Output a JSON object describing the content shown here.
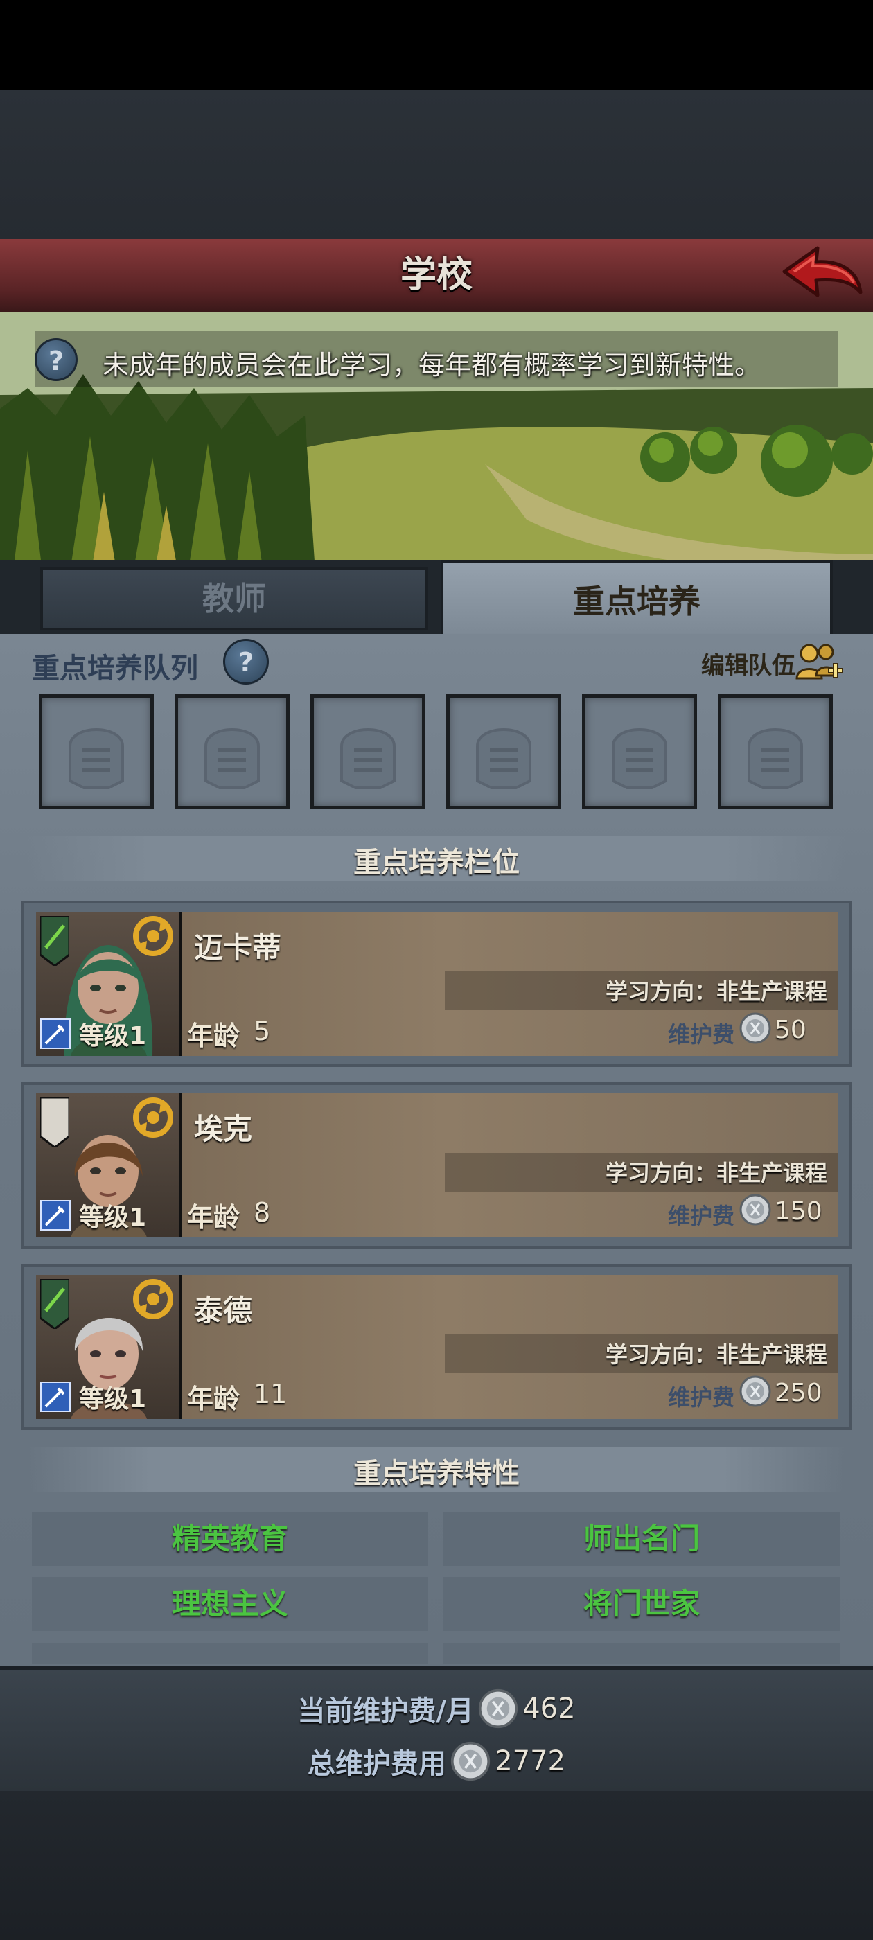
{
  "header": {
    "title": "学校"
  },
  "info": {
    "text": "未成年的成员会在此学习，每年都有概率学习到新特性。",
    "help_symbol": "?"
  },
  "tabs": [
    {
      "label": "教师",
      "active": false
    },
    {
      "label": "重点培养",
      "active": true
    }
  ],
  "queue": {
    "label": "重点培养队列",
    "help_symbol": "?",
    "edit_label": "编辑队伍",
    "slot_count": 6
  },
  "slots_section": {
    "title": "重点培养栏位"
  },
  "members": [
    {
      "name": "迈卡蒂",
      "level_label": "等级1",
      "age_label": "年龄",
      "age": "5",
      "study": "学习方向：非生产课程",
      "fee_label": "维护费",
      "fee": "50",
      "hair_color": "#2f6b4f",
      "banner": "green"
    },
    {
      "name": "埃克",
      "level_label": "等级1",
      "age_label": "年龄",
      "age": "8",
      "study": "学习方向：非生产课程",
      "fee_label": "维护费",
      "fee": "150",
      "hair_color": "#6a4427",
      "banner": "white"
    },
    {
      "name": "泰德",
      "level_label": "等级1",
      "age_label": "年龄",
      "age": "11",
      "study": "学习方向：非生产课程",
      "fee_label": "维护费",
      "fee": "250",
      "hair_color": "#c8c8c8",
      "banner": "green"
    }
  ],
  "traits_section": {
    "title": "重点培养特性"
  },
  "traits": [
    [
      "精英教育",
      "师出名门"
    ],
    [
      "理想主义",
      "将门世家"
    ]
  ],
  "footer": {
    "monthly_label": "当前维护费/月",
    "monthly_value": "462",
    "total_label": "总维护费用",
    "total_value": "2772"
  },
  "colors": {
    "title_bar": "#6a2c2e",
    "trait_text": "#4bc441",
    "panel": "#6f7b87"
  }
}
